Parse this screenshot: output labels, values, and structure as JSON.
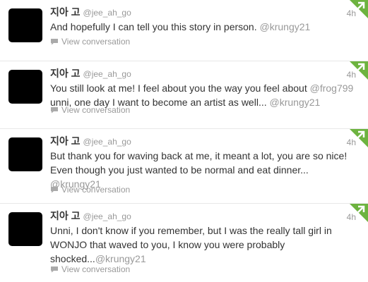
{
  "colors": {
    "avatar": "#000000",
    "mention": "#999999",
    "text": "#333333",
    "meta": "#999999",
    "corner_green": "#6db33f"
  },
  "icons": {
    "view_conversation": "speech-bubble-icon",
    "corner": "retweet-corner-icon"
  },
  "tweets": [
    {
      "fullname": "지아 고",
      "username": "@jee_ah_go",
      "time": "4h",
      "lines": [
        "And hopefully I can tell you this story in person."
      ],
      "mention": "@krungy21",
      "view_conversation": "View conversation"
    },
    {
      "fullname": "지아 고",
      "username": "@jee_ah_go",
      "time": "4h",
      "line1": "You still look at me! I feel about you the way you feel about",
      "line1_mention": "@frog799",
      "line2": "unni, one day I want to become an artist as well...",
      "mention": "@krungy21",
      "view_conversation": "View conversation"
    },
    {
      "fullname": "지아 고",
      "username": "@jee_ah_go",
      "time": "4h",
      "line1": "But thank you for waving back at me, it meant a lot, you are so nice!",
      "line2": "Even though you just wanted to be normal and eat dinner...",
      "mention": "@krungy21",
      "view_conversation": "View conversation"
    },
    {
      "fullname": "지아 고",
      "username": "@jee_ah_go",
      "time": "4h",
      "line1": "Unni, I don't know if you remember, but I was the really tall girl in",
      "line2": "WONJO that waved to you, I know you were probably",
      "line3": "shocked...",
      "mention": "@krungy21",
      "view_conversation": "View conversation"
    }
  ]
}
